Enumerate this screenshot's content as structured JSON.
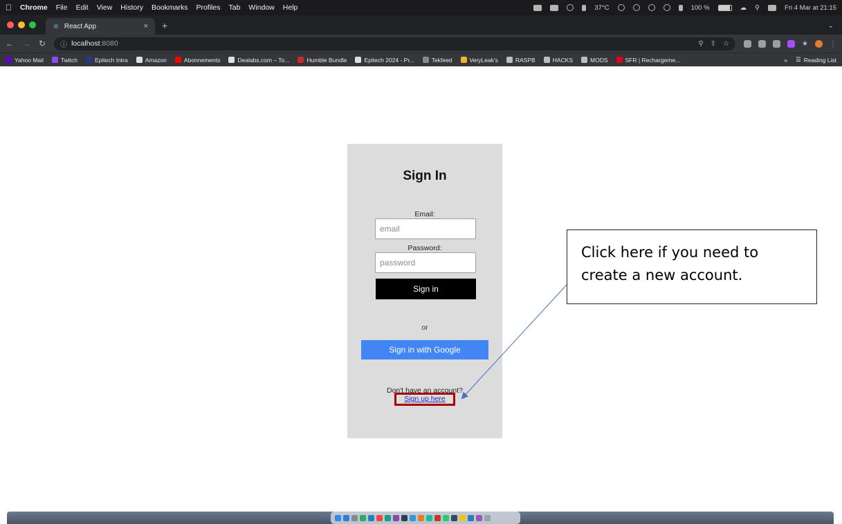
{
  "menubar": {
    "apple": "",
    "items": [
      "Chrome",
      "File",
      "Edit",
      "View",
      "History",
      "Bookmarks",
      "Profiles",
      "Tab",
      "Window",
      "Help"
    ],
    "temperature": "37°C",
    "battery": "100 %",
    "clock": "Fri 4 Mar at 21:15"
  },
  "browser": {
    "tab_title": "React App",
    "tab_close": "×",
    "new_tab": "+",
    "url_host": "localhost",
    "url_port": ":8080",
    "bookmarks": [
      {
        "label": "Yahoo Mail",
        "color": "#6001d2"
      },
      {
        "label": "Twitch",
        "color": "#9146ff"
      },
      {
        "label": "Epitech Intra",
        "color": "#1e3a8a"
      },
      {
        "label": "Amazon",
        "color": "#e0e0e0"
      },
      {
        "label": "Abonnements",
        "color": "#ff0000"
      },
      {
        "label": "Dealabs.com – To...",
        "color": "#e0e0e0"
      },
      {
        "label": "Humble Bundle",
        "color": "#cc2929"
      },
      {
        "label": "Epitech 2024 - Pr...",
        "color": "#e0e0e0"
      },
      {
        "label": "Tekfeed",
        "color": "#888888"
      },
      {
        "label": "VeryLeak's",
        "color": "#f2b233"
      },
      {
        "label": "RASPB",
        "color": "#bdbdbd"
      },
      {
        "label": "HACKS",
        "color": "#bdbdbd"
      },
      {
        "label": "MODS",
        "color": "#bdbdbd"
      },
      {
        "label": "SFR | Rechargeme...",
        "color": "#e2001a"
      }
    ],
    "bookmarks_overflow": "»",
    "reading_list": "Reading List"
  },
  "signin": {
    "title": "Sign In",
    "email_label": "Email:",
    "email_placeholder": "email",
    "password_label": "Password:",
    "password_placeholder": "password",
    "signin_button": "Sign in",
    "or_text": "or",
    "google_button": "Sign in with Google",
    "no_account_text": "Don't have an account?",
    "signup_link": "Sign up here"
  },
  "annotation": {
    "callout_line1": "Click here if you need to",
    "callout_line2": "create a new account."
  },
  "colors": {
    "card_bg": "#dcdcdc",
    "google_blue": "#4285f4",
    "highlight_red": "#a80000",
    "arrow_blue": "#4472c4"
  }
}
